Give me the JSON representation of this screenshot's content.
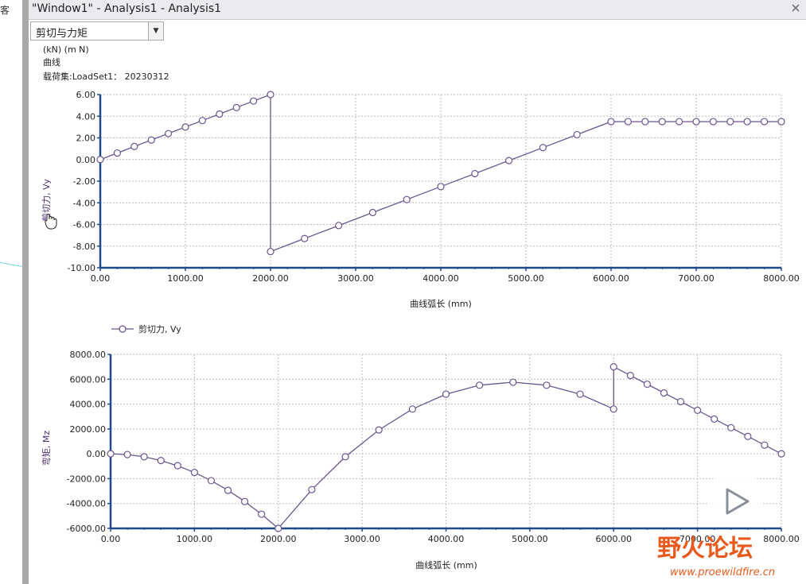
{
  "window": {
    "title": "\"Window1\" - Analysis1 - Analysis1",
    "close_icon": "close-icon",
    "left_tool_label": "客"
  },
  "selector": {
    "value": "剪切与力矩",
    "icon": "chevron-down-icon"
  },
  "header": {
    "units": "(kN)  (m N)",
    "kind": "曲线",
    "loadset": "载荷集:LoadSet1： 20230312"
  },
  "colors": {
    "series": "#6a5590",
    "axis": "#1e4a8c",
    "grid": "#bdbdbd",
    "watermark": "#e85a1b",
    "watermark_play": "#8a8f99"
  },
  "watermark": {
    "logo_text": "野火论坛",
    "url": "www.proewildfire.cn"
  },
  "chart_data": [
    {
      "type": "line",
      "xlabel": "曲线弧长 (mm)",
      "ylabel": "剪切力, Vy",
      "xlim": [
        0,
        8000
      ],
      "ylim": [
        -10,
        6
      ],
      "grid": true,
      "legend": "below-left",
      "x_ticks": [
        "0.00",
        "1000.00",
        "2000.00",
        "3000.00",
        "4000.00",
        "5000.00",
        "6000.00",
        "7000.00",
        "8000.00"
      ],
      "y_ticks": [
        "6.00",
        "4.00",
        "2.00",
        "0.00",
        "-2.00",
        "-4.00",
        "-6.00",
        "-8.00",
        "-10.00"
      ],
      "series": [
        {
          "name": "剪切力, Vy",
          "x": [
            0,
            200,
            400,
            600,
            800,
            1000,
            1200,
            1400,
            1600,
            1800,
            2000,
            2000,
            2400,
            2800,
            3200,
            3600,
            4000,
            4400,
            4800,
            5200,
            5600,
            6000,
            6200,
            6400,
            6600,
            6800,
            7000,
            7200,
            7400,
            7600,
            7800,
            8000
          ],
          "y": [
            0,
            0.6,
            1.2,
            1.8,
            2.4,
            3.0,
            3.6,
            4.2,
            4.8,
            5.4,
            6.0,
            -8.5,
            -7.3,
            -6.1,
            -4.9,
            -3.7,
            -2.5,
            -1.3,
            -0.1,
            1.1,
            2.3,
            3.5,
            3.5,
            3.5,
            3.5,
            3.5,
            3.5,
            3.5,
            3.5,
            3.5,
            3.5,
            3.5
          ]
        }
      ]
    },
    {
      "type": "line",
      "xlabel": "曲线弧长 (mm)",
      "ylabel": "弯矩, Mz",
      "xlim": [
        0,
        8000
      ],
      "ylim": [
        -6000,
        8000
      ],
      "grid": true,
      "x_ticks": [
        "0.00",
        "1000.00",
        "2000.00",
        "3000.00",
        "4000.00",
        "5000.00",
        "6000.00",
        "7000.00",
        "8000.00"
      ],
      "y_ticks": [
        "8000.00",
        "6000.00",
        "4000.00",
        "2000.00",
        "0.00",
        "-2000.00",
        "-4000.00",
        "-6000.00"
      ],
      "series": [
        {
          "name": "弯矩, Mz",
          "x": [
            0,
            200,
            400,
            600,
            800,
            1000,
            1200,
            1400,
            1600,
            1800,
            2000,
            2400,
            2800,
            3200,
            3600,
            4000,
            4400,
            4800,
            5200,
            5600,
            6000,
            6000,
            6200,
            6400,
            6600,
            6800,
            7000,
            7200,
            7400,
            7600,
            7800,
            8000
          ],
          "y": [
            0,
            -60,
            -240,
            -540,
            -960,
            -1500,
            -2160,
            -2940,
            -3840,
            -4860,
            -6000,
            -2880,
            -240,
            1920,
            3600,
            4800,
            5520,
            5760,
            5520,
            4800,
            3600,
            7000,
            6300,
            5600,
            4900,
            4200,
            3500,
            2800,
            2100,
            1400,
            700,
            0
          ]
        }
      ]
    }
  ]
}
